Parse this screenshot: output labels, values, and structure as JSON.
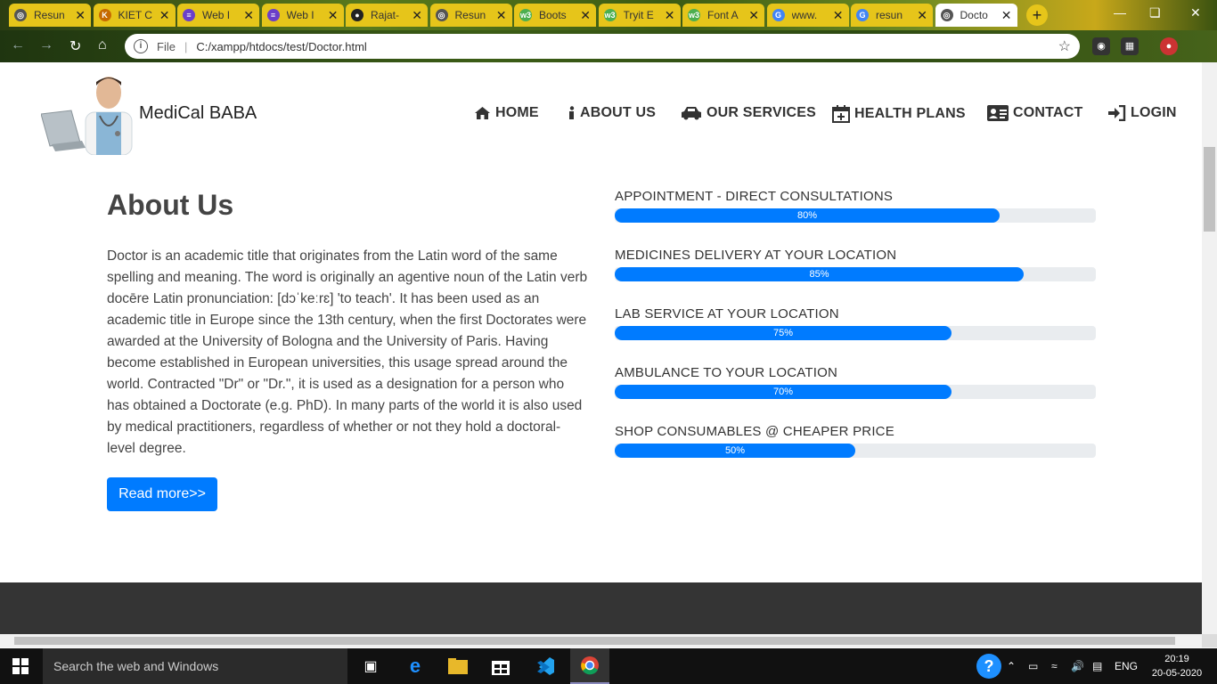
{
  "browser": {
    "tabs": [
      {
        "label": "Resun",
        "icon": "globe-icon"
      },
      {
        "label": "KIET C",
        "icon": "kiet-icon"
      },
      {
        "label": "Web I",
        "icon": "form-icon"
      },
      {
        "label": "Web I",
        "icon": "form-icon"
      },
      {
        "label": "Rajat-",
        "icon": "github-icon"
      },
      {
        "label": "Resun",
        "icon": "globe-icon"
      },
      {
        "label": "Boots",
        "icon": "w3-icon"
      },
      {
        "label": "Tryit E",
        "icon": "w3-icon"
      },
      {
        "label": "Font A",
        "icon": "w3-icon"
      },
      {
        "label": "www.",
        "icon": "google-icon"
      },
      {
        "label": "resun",
        "icon": "google-icon"
      },
      {
        "label": "Docto",
        "icon": "globe-icon"
      }
    ],
    "address": {
      "scheme": "File",
      "url": "C:/xampp/htdocs/test/Doctor.html"
    }
  },
  "site": {
    "brand": "MediCal BABA",
    "nav": [
      {
        "label": "HOME",
        "icon": "home-icon"
      },
      {
        "label": "ABOUT US",
        "icon": "info-icon"
      },
      {
        "label": "OUR SERVICES",
        "icon": "car-icon"
      },
      {
        "label": "HEALTH PLANS",
        "icon": "calendar-plus-icon"
      },
      {
        "label": "CONTACT",
        "icon": "contact-card-icon"
      },
      {
        "label": "LOGIN",
        "icon": "sign-in-icon"
      }
    ]
  },
  "about": {
    "title": "About Us",
    "text": "Doctor is an academic title that originates from the Latin word of the same spelling and meaning. The word is originally an agentive noun of the Latin verb docēre Latin pronunciation: [dɔˈkeːrɛ] 'to teach'. It has been used as an academic title in Europe since the 13th century, when the first Doctorates were awarded at the University of Bologna and the University of Paris. Having become established in European universities, this usage spread around the world. Contracted \"Dr\" or \"Dr.\", it is used as a designation for a person who has obtained a Doctorate (e.g. PhD). In many parts of the world it is also used by medical practitioners, regardless of whether or not they hold a doctoral-level degree.",
    "button": "Read more>>"
  },
  "services": [
    {
      "label": "APPOINTMENT - DIRECT CONSULTATIONS",
      "percent": 80,
      "text": "80%"
    },
    {
      "label": "MEDICINES DELIVERY AT YOUR LOCATION",
      "percent": 85,
      "text": "85%"
    },
    {
      "label": "LAB SERVICE AT YOUR LOCATION",
      "percent": 70,
      "text": "75%"
    },
    {
      "label": "AMBULANCE TO YOUR LOCATION",
      "percent": 70,
      "text": "70%"
    },
    {
      "label": "SHOP CONSUMABLES @ CHEAPER PRICE",
      "percent": 50,
      "text": "50%"
    }
  ],
  "taskbar": {
    "search_placeholder": "Search the web and Windows",
    "language": "ENG",
    "time": "20:19",
    "date": "20-05-2020"
  },
  "colors": {
    "primary": "#007bff",
    "tab_yellow": "#e6c51a",
    "footer": "#343434"
  }
}
